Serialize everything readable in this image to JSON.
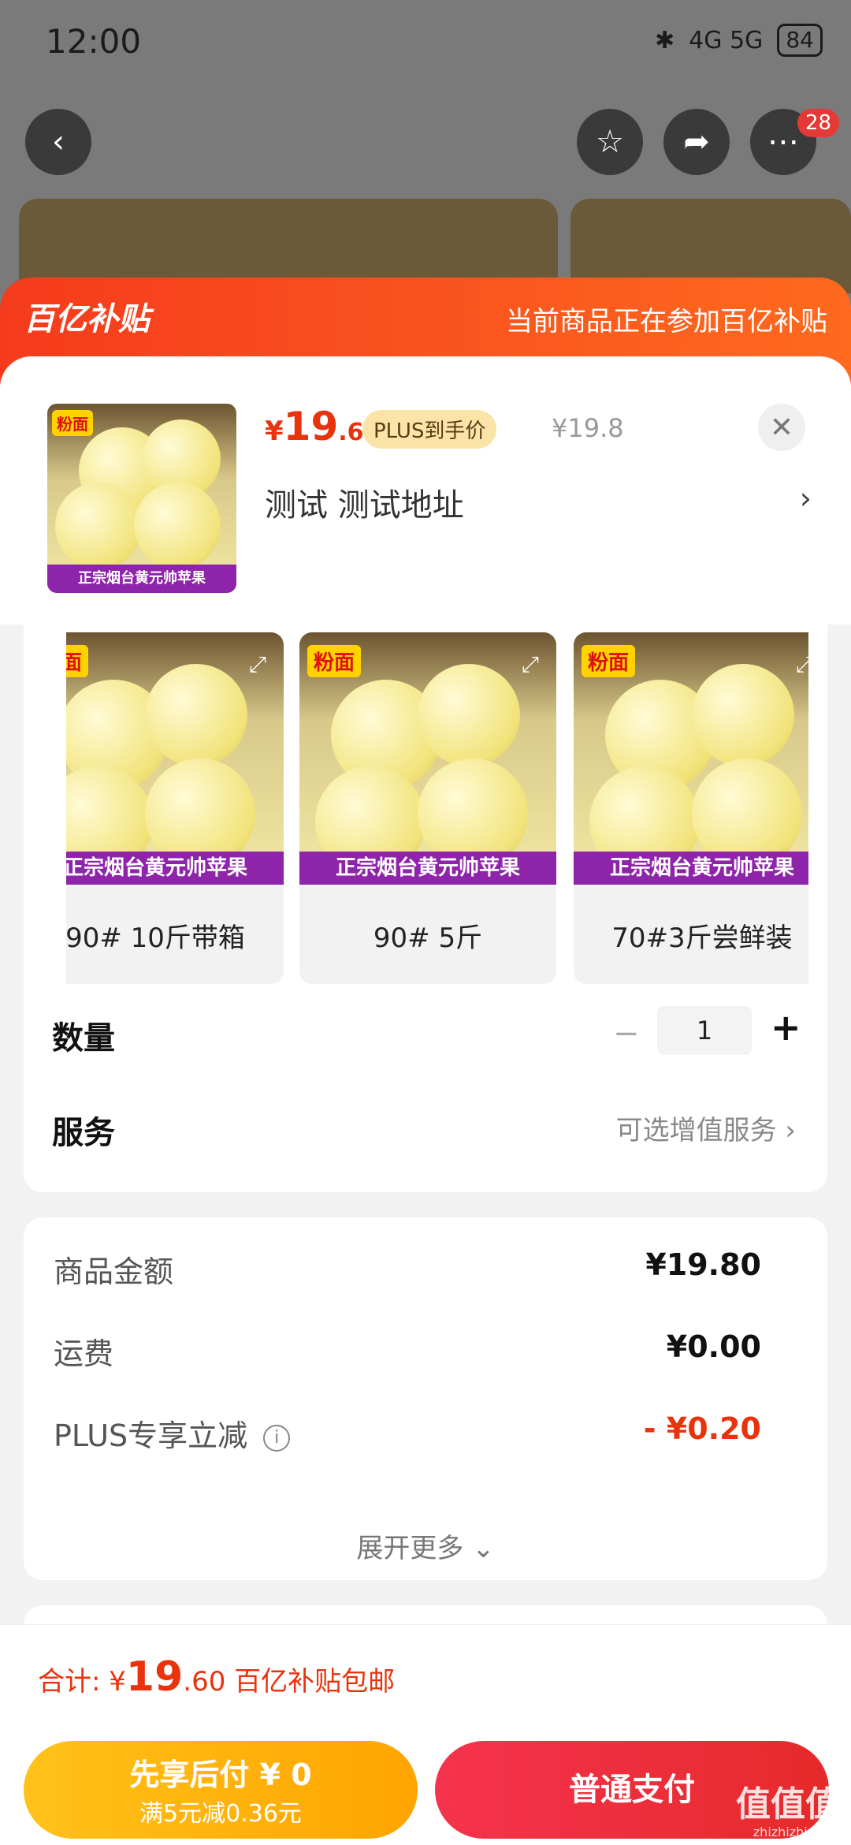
{
  "status": {
    "time": "12:00",
    "signal": "4G 5G",
    "battery": "84"
  },
  "nav": {
    "badge": "28"
  },
  "banner": {
    "logo_text": "百亿补贴",
    "desc": "当前商品正在参加百亿补贴"
  },
  "product": {
    "price_yen": "¥",
    "price_int": "19",
    "price_dec": ".6",
    "plus_tag": "PLUS到手价",
    "orig_price": "¥19.8",
    "address": "测试  测试地址",
    "thumb_tag": "粉面",
    "thumb_strip": "正宗烟台黄元帅苹果"
  },
  "specs": [
    {
      "tag": "粉面",
      "strip": "正宗烟台黄元帅苹果",
      "label": "90# 10斤带箱"
    },
    {
      "tag": "粉面",
      "strip": "正宗烟台黄元帅苹果",
      "label": "90# 5斤"
    },
    {
      "tag": "粉面",
      "strip": "正宗烟台黄元帅苹果",
      "label": "70#3斤尝鲜装"
    }
  ],
  "quantity": {
    "label": "数量",
    "value": "1",
    "minus": "−",
    "plus": "+"
  },
  "service": {
    "label": "服务",
    "hint": "可选增值服务"
  },
  "fees": {
    "goods_label": "商品金额",
    "goods_value": "¥19.80",
    "ship_label": "运费",
    "ship_value": "¥0.00",
    "plus_label": "PLUS专享立减",
    "plus_value": "- ¥0.20",
    "expand": "展开更多"
  },
  "total": {
    "label": "合计: ¥",
    "int": "19",
    "dec": ".60",
    "note": "百亿补贴包邮"
  },
  "actions": {
    "later_line1": "先享后付 ¥ 0",
    "later_line2": "满5元减0.36元",
    "pay": "普通支付"
  },
  "watermark": {
    "text": "值值值",
    "sub": "zhizhizhi.com"
  }
}
